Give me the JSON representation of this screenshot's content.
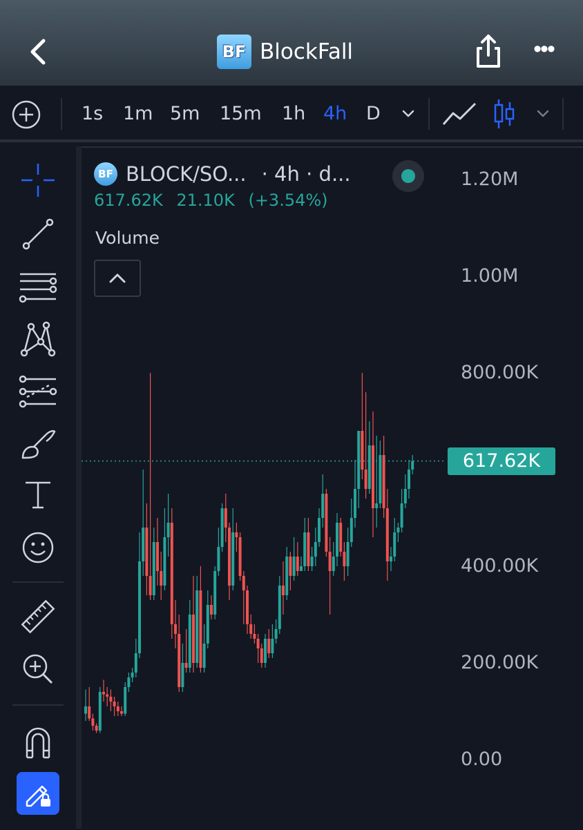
{
  "header": {
    "back_icon": "chevron-left-icon",
    "logo_text": "BF",
    "title": "BlockFall",
    "share_icon": "share-icon",
    "more_icon": "more-horizontal-icon",
    "more_glyph": "•••"
  },
  "toolbar": {
    "add_icon": "plus-circle-icon",
    "intervals": [
      "1s",
      "1m",
      "5m",
      "15m",
      "1h",
      "4h",
      "D"
    ],
    "active_interval": "4h",
    "interval_dropdown_icon": "chevron-down-icon",
    "line_chart_icon": "line-chart-icon",
    "candle_chart_icon": "candlestick-icon",
    "chart_type_dropdown_icon": "chevron-down-icon",
    "active_color": "#2962ff"
  },
  "left_tools": [
    "crosshair-icon",
    "trend-line-icon",
    "horizontal-lines-icon",
    "pattern-icon",
    "fib-icon",
    "brush-icon",
    "text-tool-icon",
    "emoji-icon",
    "ruler-icon",
    "zoom-in-icon",
    "magnet-icon",
    "lock-drawing-icon"
  ],
  "legend": {
    "logo_text": "BF",
    "symbol": "BLOCK/SO...",
    "timeframe": "· 4h · d...",
    "last": "617.62K",
    "change": "21.10K",
    "change_pct": "(+3.54%)",
    "volume_label": "Volume",
    "status_color": "#26a69a"
  },
  "chart_data": {
    "type": "candlestick",
    "ylim": [
      0,
      1200000
    ],
    "yticks": [
      "1.20M",
      "1.00M",
      "800.00K",
      "400.00K",
      "200.00K",
      "0.00"
    ],
    "last_price": 617620,
    "last_price_label": "617.62K",
    "up_color": "#26a69a",
    "down_color": "#ef5350",
    "candles": [
      [
        95000,
        110000,
        80000,
        145000
      ],
      [
        110000,
        85000,
        80000,
        150000
      ],
      [
        85000,
        70000,
        60000,
        95000
      ],
      [
        70000,
        60000,
        55000,
        75000
      ],
      [
        60000,
        140000,
        55000,
        150000
      ],
      [
        140000,
        135000,
        120000,
        165000
      ],
      [
        135000,
        130000,
        110000,
        150000
      ],
      [
        130000,
        120000,
        100000,
        145000
      ],
      [
        120000,
        110000,
        90000,
        130000
      ],
      [
        110000,
        100000,
        90000,
        120000
      ],
      [
        100000,
        95000,
        90000,
        110000
      ],
      [
        95000,
        150000,
        90000,
        160000
      ],
      [
        150000,
        170000,
        140000,
        180000
      ],
      [
        170000,
        180000,
        160000,
        190000
      ],
      [
        180000,
        220000,
        170000,
        250000
      ],
      [
        220000,
        410000,
        210000,
        470000
      ],
      [
        410000,
        480000,
        380000,
        600000
      ],
      [
        480000,
        380000,
        340000,
        530000
      ],
      [
        380000,
        340000,
        330000,
        800000
      ],
      [
        340000,
        450000,
        330000,
        480000
      ],
      [
        450000,
        390000,
        360000,
        500000
      ],
      [
        390000,
        360000,
        330000,
        430000
      ],
      [
        360000,
        460000,
        350000,
        520000
      ],
      [
        460000,
        490000,
        420000,
        550000
      ],
      [
        490000,
        280000,
        250000,
        520000
      ],
      [
        280000,
        260000,
        230000,
        330000
      ],
      [
        260000,
        150000,
        140000,
        300000
      ],
      [
        150000,
        200000,
        140000,
        240000
      ],
      [
        200000,
        190000,
        180000,
        270000
      ],
      [
        190000,
        300000,
        180000,
        330000
      ],
      [
        300000,
        200000,
        180000,
        380000
      ],
      [
        200000,
        350000,
        190000,
        380000
      ],
      [
        350000,
        190000,
        180000,
        400000
      ],
      [
        190000,
        240000,
        180000,
        280000
      ],
      [
        240000,
        320000,
        230000,
        350000
      ],
      [
        320000,
        300000,
        290000,
        340000
      ],
      [
        300000,
        390000,
        290000,
        400000
      ],
      [
        390000,
        440000,
        380000,
        480000
      ],
      [
        440000,
        520000,
        430000,
        530000
      ],
      [
        520000,
        480000,
        450000,
        550000
      ],
      [
        480000,
        360000,
        330000,
        490000
      ],
      [
        360000,
        470000,
        350000,
        520000
      ],
      [
        470000,
        460000,
        430000,
        490000
      ],
      [
        460000,
        380000,
        370000,
        470000
      ],
      [
        380000,
        350000,
        280000,
        390000
      ],
      [
        350000,
        280000,
        260000,
        360000
      ],
      [
        280000,
        260000,
        250000,
        300000
      ],
      [
        260000,
        250000,
        240000,
        280000
      ],
      [
        250000,
        230000,
        200000,
        260000
      ],
      [
        230000,
        200000,
        190000,
        240000
      ],
      [
        200000,
        250000,
        190000,
        260000
      ],
      [
        250000,
        220000,
        210000,
        270000
      ],
      [
        220000,
        250000,
        210000,
        280000
      ],
      [
        250000,
        270000,
        240000,
        290000
      ],
      [
        270000,
        360000,
        260000,
        380000
      ],
      [
        360000,
        340000,
        300000,
        410000
      ],
      [
        340000,
        420000,
        330000,
        440000
      ],
      [
        420000,
        380000,
        350000,
        430000
      ],
      [
        380000,
        420000,
        370000,
        460000
      ],
      [
        420000,
        390000,
        380000,
        450000
      ],
      [
        390000,
        400000,
        390000,
        420000
      ],
      [
        400000,
        470000,
        390000,
        500000
      ],
      [
        470000,
        400000,
        390000,
        500000
      ],
      [
        400000,
        420000,
        390000,
        440000
      ],
      [
        420000,
        450000,
        400000,
        480000
      ],
      [
        450000,
        500000,
        440000,
        520000
      ],
      [
        500000,
        550000,
        480000,
        590000
      ],
      [
        550000,
        430000,
        420000,
        560000
      ],
      [
        430000,
        390000,
        300000,
        460000
      ],
      [
        390000,
        420000,
        380000,
        450000
      ],
      [
        420000,
        490000,
        400000,
        510000
      ],
      [
        490000,
        430000,
        420000,
        500000
      ],
      [
        430000,
        400000,
        370000,
        450000
      ],
      [
        400000,
        450000,
        380000,
        480000
      ],
      [
        450000,
        500000,
        440000,
        540000
      ],
      [
        500000,
        560000,
        480000,
        620000
      ],
      [
        560000,
        680000,
        520000,
        680000
      ],
      [
        680000,
        600000,
        580000,
        800000
      ],
      [
        600000,
        560000,
        540000,
        760000
      ],
      [
        560000,
        650000,
        550000,
        700000
      ],
      [
        650000,
        520000,
        460000,
        720000
      ],
      [
        520000,
        530000,
        480000,
        670000
      ],
      [
        530000,
        630000,
        520000,
        660000
      ],
      [
        630000,
        520000,
        500000,
        670000
      ],
      [
        520000,
        410000,
        370000,
        560000
      ],
      [
        410000,
        420000,
        390000,
        440000
      ],
      [
        420000,
        470000,
        410000,
        500000
      ],
      [
        470000,
        480000,
        450000,
        490000
      ],
      [
        480000,
        530000,
        470000,
        560000
      ],
      [
        530000,
        560000,
        520000,
        590000
      ],
      [
        560000,
        600000,
        540000,
        620000
      ],
      [
        600000,
        617620,
        590000,
        630000
      ]
    ]
  }
}
